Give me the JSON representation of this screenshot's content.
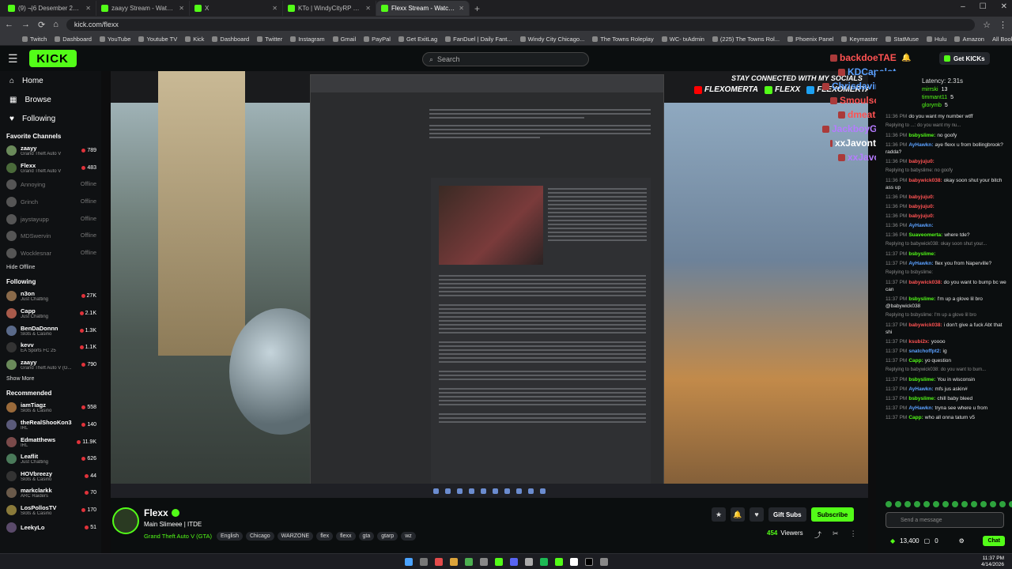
{
  "browser": {
    "tabs": [
      {
        "title": "(9) ¬|6 Desember 25 Aceh Tam",
        "active": false
      },
      {
        "title": "zaayy Stream - Watch Live on K",
        "active": false
      },
      {
        "title": "X",
        "active": false
      },
      {
        "title": "KTo | WindyCityRP Wiki | Fand",
        "active": false
      },
      {
        "title": "Flexx Stream - Watch Live o",
        "active": true
      }
    ],
    "url": "kick.com/flexx",
    "bookmarks": [
      "Twitch",
      "Dashboard",
      "YouTube",
      "Youtube TV",
      "Kick",
      "Dashboard",
      "Twitter",
      "Instagram",
      "Gmail",
      "PayPal",
      "Get ExitLag",
      "FanDuel | Daily Fant...",
      "Windy City Chicago...",
      "The Towns Roleplay",
      "WC- txAdmin",
      "(225) The Towns Rol...",
      "Phoenix Panel",
      "Keymaster",
      "StatMuse",
      "Hulu",
      "Amazon"
    ],
    "all_bookmarks": "All Bookmarks"
  },
  "header": {
    "logo": "KICK",
    "search_placeholder": "Search",
    "get_kicks": "Get KICKs"
  },
  "sidebar": {
    "nav": [
      {
        "label": "Home",
        "icon": "home-icon"
      },
      {
        "label": "Browse",
        "icon": "browse-icon"
      },
      {
        "label": "Following",
        "icon": "heart-icon"
      }
    ],
    "favorite_title": "Favorite Channels",
    "favorites": [
      {
        "name": "zaayy",
        "game": "Grand Theft Auto V",
        "viewers": "789",
        "color": "#6a8a5a"
      },
      {
        "name": "Flexx",
        "game": "Grand Theft Auto V",
        "viewers": "483",
        "color": "#4a6a3a"
      },
      {
        "name": "Annoying",
        "game": "",
        "viewers": "Offline",
        "color": "#555"
      },
      {
        "name": "Grinch",
        "game": "",
        "viewers": "Offline",
        "color": "#555"
      },
      {
        "name": "jaystayupp",
        "game": "",
        "viewers": "Offline",
        "color": "#555"
      },
      {
        "name": "MDSwervin",
        "game": "",
        "viewers": "Offline",
        "color": "#555"
      },
      {
        "name": "Wocklesnar",
        "game": "",
        "viewers": "Offline",
        "color": "#555"
      }
    ],
    "hide_offline": "Hide Offline",
    "following_title": "Following",
    "following": [
      {
        "name": "n3on",
        "game": "Just Chatting",
        "viewers": "27K",
        "color": "#8a6a4a"
      },
      {
        "name": "Capp",
        "game": "Just Chatting",
        "viewers": "2.1K",
        "color": "#a85a4a"
      },
      {
        "name": "BenDaDonnn",
        "game": "Slots & Casino",
        "viewers": "1.3K",
        "color": "#5a6a8a"
      },
      {
        "name": "kevv",
        "game": "EA Sports FC 25",
        "viewers": "1.1K",
        "color": "#333"
      },
      {
        "name": "zaayy",
        "game": "Grand Theft Auto V (G...",
        "viewers": "790",
        "color": "#6a8a5a"
      }
    ],
    "show_more": "Show More",
    "recommended_title": "Recommended",
    "recommended": [
      {
        "name": "iamTiagz",
        "game": "Slots & Casino",
        "viewers": "558",
        "color": "#9a6a3a"
      },
      {
        "name": "theRealShooKon3",
        "game": "IRL",
        "viewers": "140",
        "color": "#5a5a7a"
      },
      {
        "name": "Edmatthews",
        "game": "IRL",
        "viewers": "11.9K",
        "color": "#7a4a4a"
      },
      {
        "name": "Leaflit",
        "game": "Just Chatting",
        "viewers": "626",
        "color": "#4a7a5a"
      },
      {
        "name": "HOVbreezy",
        "game": "Slots & Casino",
        "viewers": "44",
        "color": "#333"
      },
      {
        "name": "markclarkk",
        "game": "ARC Raiders",
        "viewers": "70",
        "color": "#6a5a4a"
      },
      {
        "name": "LosPollosTV",
        "game": "Slots & Casino",
        "viewers": "170",
        "color": "#8a7a3a"
      },
      {
        "name": "LeekyLo",
        "game": "",
        "viewers": "51",
        "color": "#5a4a6a"
      }
    ]
  },
  "video": {
    "overlay_title": "STAY CONNECTED WITH MY SOCIALS",
    "socials": [
      {
        "label": "FLEXOMERTA",
        "color": "#ff0000"
      },
      {
        "label": "FLEXX",
        "color": "#53fc18"
      },
      {
        "label": "FLEXOMERTA",
        "color": "#1da1f2"
      }
    ],
    "mini_chat": [
      {
        "user": "backdoeTAE",
        "color": "#ff5252"
      },
      {
        "user": "KDCapalot",
        "color": "#5aa0ff"
      },
      {
        "user": "Chrisdavindz",
        "color": "#5aa0ff"
      },
      {
        "user": "Smoulson",
        "color": "#ff5252"
      },
      {
        "user": "dmeatsu",
        "color": "#ff5252"
      },
      {
        "user": "JackboyGuapo",
        "color": "#b57bff"
      },
      {
        "user": "xxJavonte : dj was mad",
        "color": "#ffffff"
      },
      {
        "user": "xxJavonte",
        "color": "#b57bff"
      }
    ]
  },
  "stream": {
    "name": "Flexx",
    "title": "Main Slimeee | ITDE",
    "game": "Grand Theft Auto V (GTA)",
    "tags": [
      "English",
      "Chicago",
      "WARZONE",
      "flex",
      "flexx",
      "gta",
      "gtarp",
      "wz"
    ],
    "gift_subs": "Gift Subs",
    "subscribe": "Subscribe",
    "viewers": "454",
    "viewers_label": "Viewers"
  },
  "chat": {
    "latency": "Latency: 2.31s",
    "gifters": [
      {
        "name": "mirrski",
        "count": "13"
      },
      {
        "name": "timmant11",
        "count": "5"
      },
      {
        "name": "glorymb",
        "count": "5"
      }
    ],
    "messages": [
      {
        "time": "11:36 PM",
        "user": "",
        "color": "#ff5252",
        "text": "do you want my number wtff",
        "reply": false
      },
      {
        "time": "",
        "user": "",
        "color": "#8a8a8a",
        "text": "Replying to ...: do you want my nu...",
        "reply": true
      },
      {
        "time": "11:36 PM",
        "user": "bsbyslime:",
        "color": "#53fc18",
        "text": "no goofy",
        "reply": false
      },
      {
        "time": "11:36 PM",
        "user": "AyHawkn:",
        "color": "#5aa0ff",
        "text": "aye flexx u from bollingbrook?radda?",
        "reply": false
      },
      {
        "time": "11:36 PM",
        "user": "babyjuju0:",
        "color": "#ff5252",
        "text": "",
        "reply": false
      },
      {
        "time": "",
        "user": "",
        "color": "#8a8a8a",
        "text": "Replying to babyslime: no goofy",
        "reply": true
      },
      {
        "time": "11:36 PM",
        "user": "babywick038:",
        "color": "#ff5252",
        "text": "okay soon shut your bitch ass up",
        "reply": false
      },
      {
        "time": "11:36 PM",
        "user": "babyjuju0:",
        "color": "#ff5252",
        "text": "",
        "reply": false
      },
      {
        "time": "11:36 PM",
        "user": "babyjuju0:",
        "color": "#ff5252",
        "text": "",
        "reply": false
      },
      {
        "time": "11:36 PM",
        "user": "babyjuju0:",
        "color": "#ff5252",
        "text": "",
        "reply": false
      },
      {
        "time": "11:36 PM",
        "user": "AyHawkn:",
        "color": "#5aa0ff",
        "text": "",
        "reply": false
      },
      {
        "time": "11:36 PM",
        "user": "Suaveomerta:",
        "color": "#53fc18",
        "text": "where tde?",
        "reply": false
      },
      {
        "time": "",
        "user": "",
        "color": "#8a8a8a",
        "text": "Replying to babywick038: okay soon shut your...",
        "reply": true
      },
      {
        "time": "11:37 PM",
        "user": "bsbyslime:",
        "color": "#53fc18",
        "text": "",
        "reply": false
      },
      {
        "time": "11:37 PM",
        "user": "AyHawkn:",
        "color": "#5aa0ff",
        "text": "flex you from Naperville?",
        "reply": false
      },
      {
        "time": "",
        "user": "",
        "color": "#8a8a8a",
        "text": "Replying to bsbyslime:",
        "reply": true
      },
      {
        "time": "11:37 PM",
        "user": "babywick038:",
        "color": "#ff5252",
        "text": "do you want to bump bc we can",
        "reply": false
      },
      {
        "time": "11:37 PM",
        "user": "bsbyslime:",
        "color": "#53fc18",
        "text": "I'm up a glove lil bro @babywick038",
        "reply": false
      },
      {
        "time": "",
        "user": "",
        "color": "#8a8a8a",
        "text": "Replying to bsbyslime: I'm up a glove lil bro",
        "reply": true
      },
      {
        "time": "11:37 PM",
        "user": "babywick038:",
        "color": "#ff5252",
        "text": "i don't give a fuck Abt that shi",
        "reply": false
      },
      {
        "time": "11:37 PM",
        "user": "ksubi2x:",
        "color": "#ff5252",
        "text": "yoooo",
        "reply": false
      },
      {
        "time": "11:37 PM",
        "user": "snatchoffpt2:",
        "color": "#5aa0ff",
        "text": "ig",
        "reply": false
      },
      {
        "time": "11:37 PM",
        "user": "Capp:",
        "color": "#53fc18",
        "text": "yo question",
        "reply": false
      },
      {
        "time": "",
        "user": "",
        "color": "#8a8a8a",
        "text": "Replying to babywick038: do you want to bum...",
        "reply": true
      },
      {
        "time": "11:37 PM",
        "user": "bsbyslime:",
        "color": "#53fc18",
        "text": "You in wisconsin",
        "reply": false
      },
      {
        "time": "11:37 PM",
        "user": "AyHawkn:",
        "color": "#5aa0ff",
        "text": "mfs jus askin#",
        "reply": false
      },
      {
        "time": "11:37 PM",
        "user": "bsbyslime:",
        "color": "#53fc18",
        "text": "chill baby bleed",
        "reply": false
      },
      {
        "time": "11:37 PM",
        "user": "AyHawkn:",
        "color": "#5aa0ff",
        "text": "tryna see where u from",
        "reply": false
      },
      {
        "time": "11:37 PM",
        "user": "Capp:",
        "color": "#53fc18",
        "text": "who all onna tatum v5",
        "reply": false
      }
    ],
    "input_placeholder": "Send a message",
    "kicks_count": "13,400",
    "points": "0",
    "chat_button": "Chat"
  },
  "system": {
    "time": "11:37 PM",
    "date": "4/14/2026"
  }
}
